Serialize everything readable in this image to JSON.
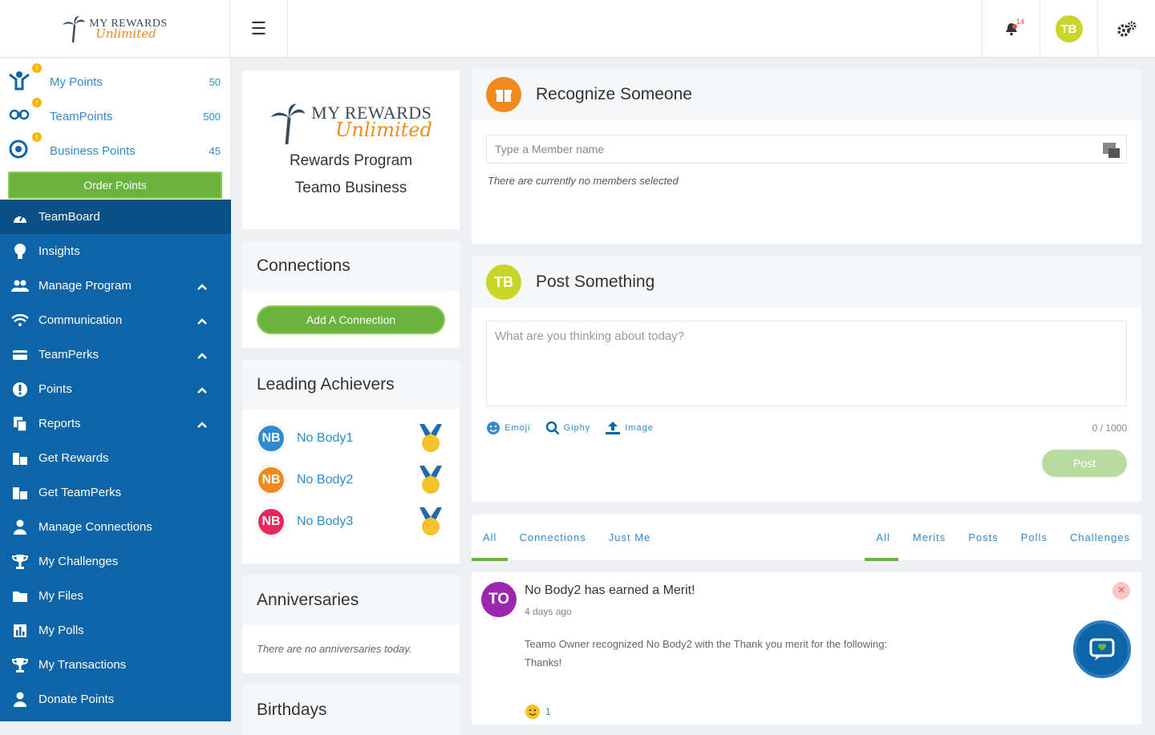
{
  "header": {
    "logo": {
      "line1": "MY REWARDS",
      "line2": "Unlimited"
    },
    "notification_count": "14",
    "user_initials": "TB"
  },
  "points": [
    {
      "label": "My Points",
      "value": "50",
      "icon": "user-star-icon"
    },
    {
      "label": "TeamPoints",
      "value": "500",
      "icon": "team-icon"
    },
    {
      "label": "Business Points",
      "value": "45",
      "icon": "target-icon"
    }
  ],
  "order_points_label": "Order Points",
  "nav": [
    {
      "label": "TeamBoard",
      "icon": "dashboard-icon",
      "active": true,
      "chevron": false
    },
    {
      "label": "Insights",
      "icon": "lightbulb-icon",
      "chevron": false
    },
    {
      "label": "Manage Program",
      "icon": "users-icon",
      "chevron": true
    },
    {
      "label": "Communication",
      "icon": "wifi-icon",
      "chevron": true
    },
    {
      "label": "TeamPerks",
      "icon": "card-icon",
      "chevron": true
    },
    {
      "label": "Points",
      "icon": "info-icon",
      "chevron": true
    },
    {
      "label": "Reports",
      "icon": "copy-icon",
      "chevron": true
    },
    {
      "label": "Get Rewards",
      "icon": "building-icon",
      "chevron": false
    },
    {
      "label": "Get TeamPerks",
      "icon": "building-icon",
      "chevron": false
    },
    {
      "label": "Manage Connections",
      "icon": "user-icon",
      "chevron": false
    },
    {
      "label": "My Challenges",
      "icon": "trophy-icon",
      "chevron": false
    },
    {
      "label": "My Files",
      "icon": "folder-icon",
      "chevron": false
    },
    {
      "label": "My Polls",
      "icon": "poll-icon",
      "chevron": false
    },
    {
      "label": "My Transactions",
      "icon": "trophy-icon",
      "chevron": false
    },
    {
      "label": "Donate Points",
      "icon": "user-icon",
      "chevron": false
    }
  ],
  "brand_card": {
    "logo_line1": "MY REWARDS",
    "logo_line2": "Unlimited",
    "program": "Rewards Program",
    "business": "Teamo Business"
  },
  "connections": {
    "title": "Connections",
    "button": "Add A Connection"
  },
  "achievers": {
    "title": "Leading Achievers",
    "items": [
      {
        "initials": "NB",
        "name": "No Body1",
        "color": "#2e8bd1"
      },
      {
        "initials": "NB",
        "name": "No Body2",
        "color": "#f08a1c"
      },
      {
        "initials": "NB",
        "name": "No Body3",
        "color": "#e8285a"
      }
    ]
  },
  "anniversaries": {
    "title": "Anniversaries",
    "note": "There are no anniversaries today."
  },
  "birthdays": {
    "title": "Birthdays"
  },
  "recognize": {
    "title": "Recognize Someone",
    "placeholder": "Type a Member name",
    "note": "There are currently no members selected"
  },
  "post": {
    "title": "Post Something",
    "initials": "TB",
    "placeholder": "What are you thinking about today?",
    "tools": [
      "Emoji",
      "Giphy",
      "Image"
    ],
    "counter": "0 / 1000",
    "button": "Post"
  },
  "tabs_left": [
    "All",
    "Connections",
    "Just Me"
  ],
  "tabs_right": [
    "All",
    "Merits",
    "Posts",
    "Polls",
    "Challenges"
  ],
  "feed": {
    "initials": "TO",
    "title": "No Body2 has earned a Merit!",
    "time": "4 days ago",
    "body": "Teamo Owner recognized No Body2 with the Thank you merit for the following:",
    "body2": "Thanks!",
    "reaction_count": "1"
  },
  "colors": {
    "primary": "#0d65a8",
    "green": "#6ab43e",
    "link": "#2e8bd1",
    "orange": "#f08a1c"
  }
}
